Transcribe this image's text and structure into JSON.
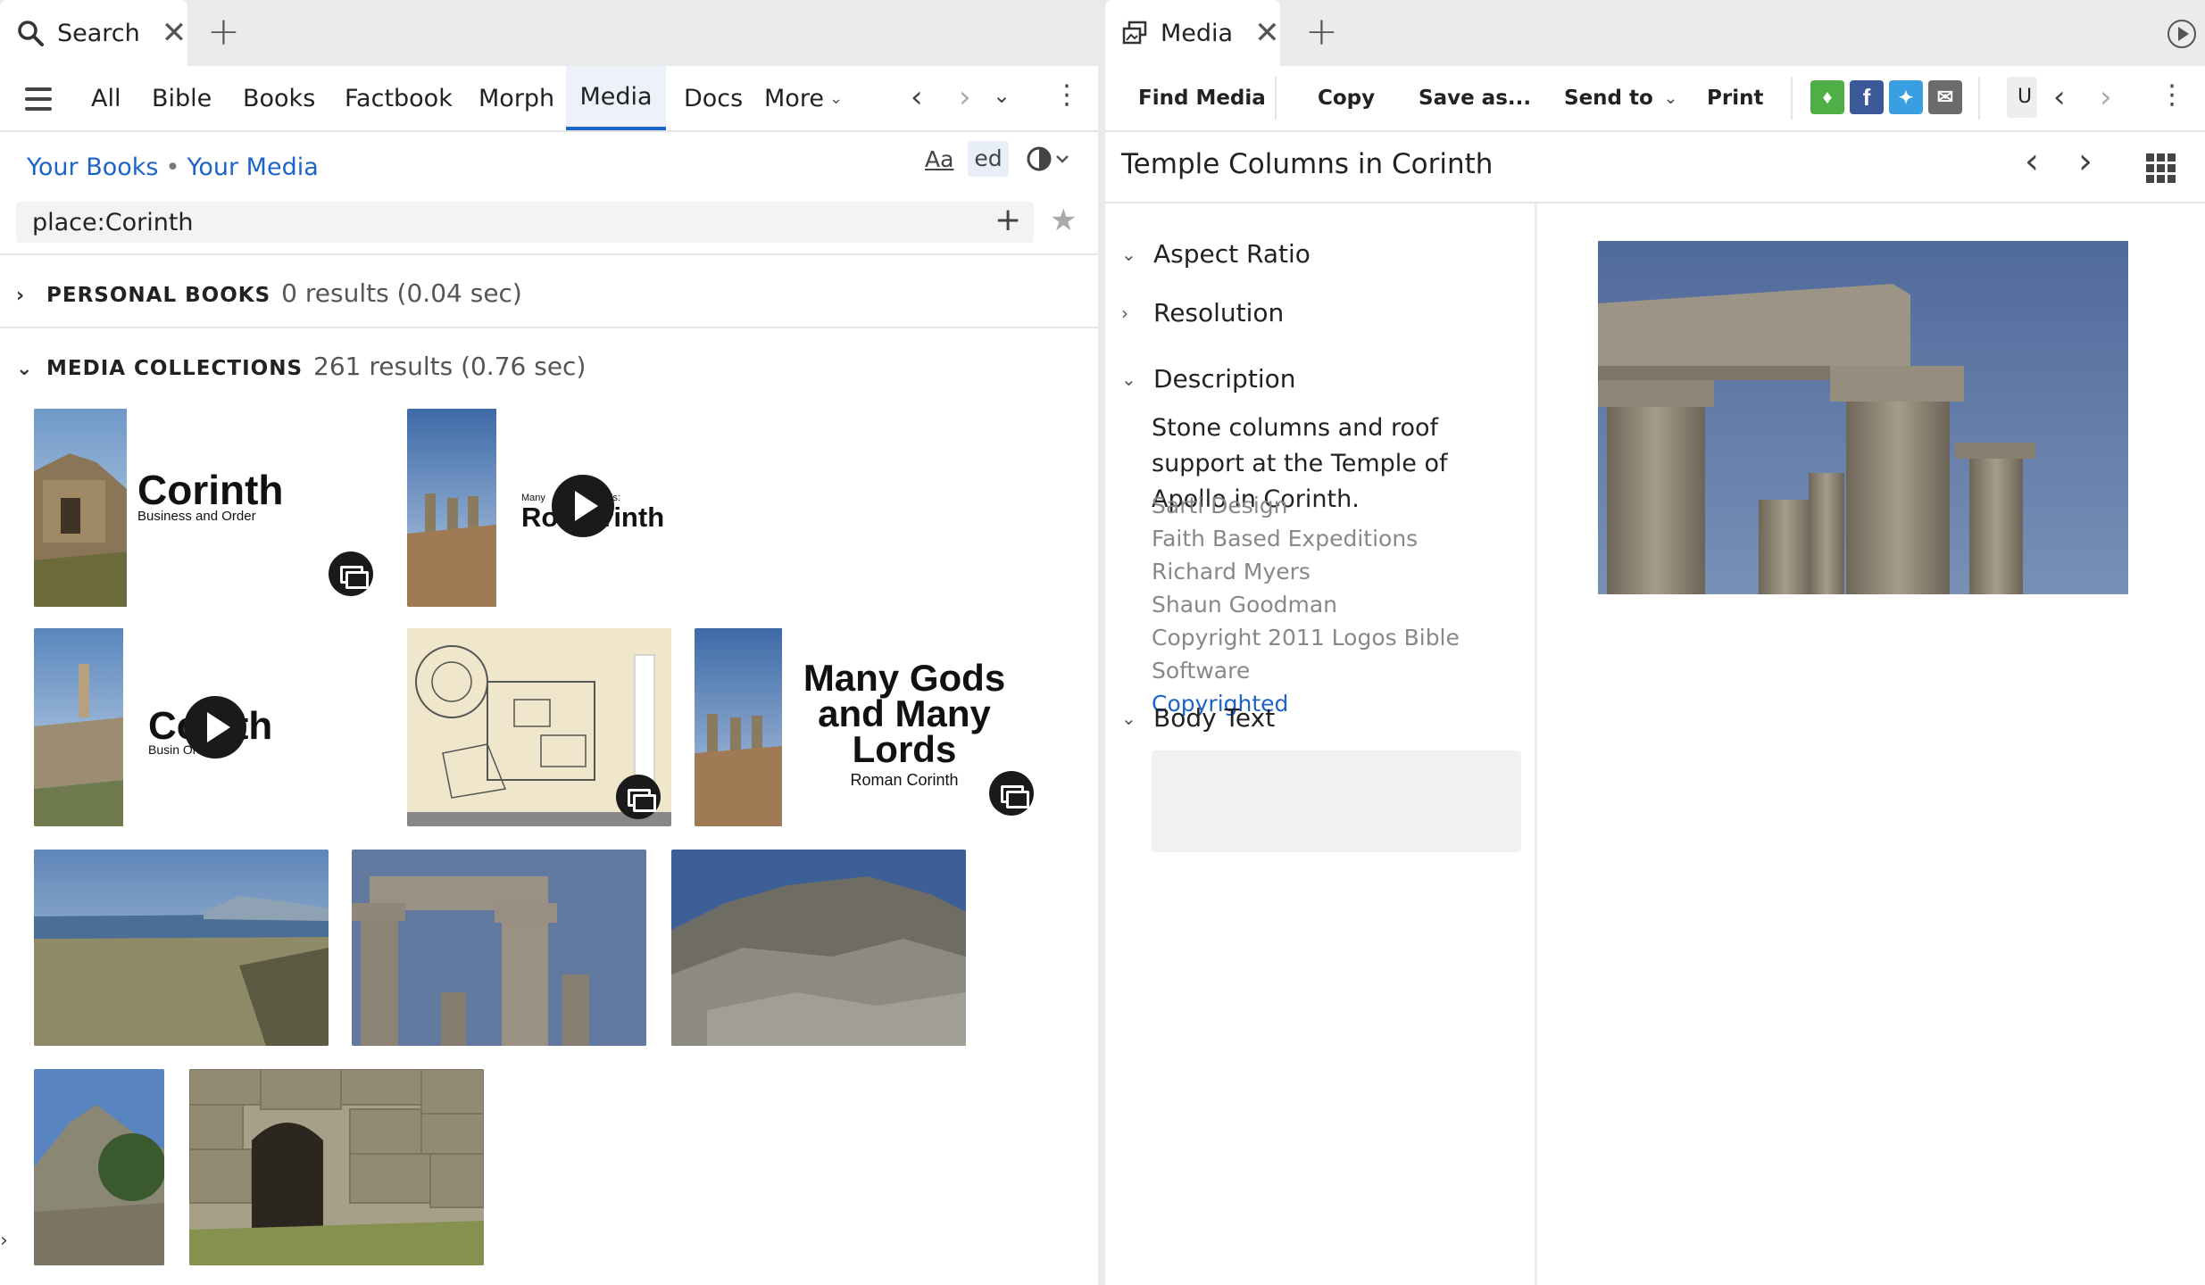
{
  "left_panel": {
    "tab": {
      "label": "Search",
      "icon": "search-icon"
    },
    "nav": [
      "All",
      "Bible",
      "Books",
      "Factbook",
      "Morph",
      "Media",
      "Docs",
      "More"
    ],
    "active_nav": "Media",
    "breadcrumb": [
      "Your Books",
      "Your Media"
    ],
    "toolbar_icons": {
      "font": "Aa",
      "highlight": "ed"
    },
    "search_query": "place:Corinth",
    "personal_books": {
      "label": "PERSONAL BOOKS",
      "results": "0 results (0.04 sec)"
    },
    "media_collections": {
      "label": "MEDIA COLLECTIONS",
      "results": "261 results (0.76 sec)"
    },
    "thumbnails": {
      "t1": {
        "title": "Corinth",
        "subtitle": "Business and Order"
      },
      "t2": {
        "pre": "Many",
        "pre2": "lords:",
        "title": "Ro Corinth"
      },
      "t3": {
        "title": "Co nth",
        "subtitle": "Busin Order"
      },
      "t5": {
        "title": "Many Gods and Many Lords",
        "subtitle": "Roman Corinth"
      }
    }
  },
  "right_panel": {
    "tab": {
      "label": "Media",
      "icon": "media-icon"
    },
    "toolbar": [
      "Find Media",
      "Copy",
      "Save as...",
      "Send to",
      "Print"
    ],
    "partial_button": "U",
    "title": "Temple Columns in Corinth",
    "sections": {
      "aspect_ratio": "Aspect Ratio",
      "resolution": "Resolution",
      "description": "Description",
      "body_text": "Body Text"
    },
    "description_text": "Stone columns and roof support at the Temple of Apollo in Corinth.",
    "credits": [
      "Sarti Design",
      "Faith Based Expeditions",
      "Richard Myers",
      "Shaun Goodman",
      "Copyright 2011 Logos Bible Software"
    ],
    "copyright_link": "Copyrighted"
  },
  "colors": {
    "accent": "#1d64c8",
    "active_tab_bg": "#edf2fa"
  }
}
